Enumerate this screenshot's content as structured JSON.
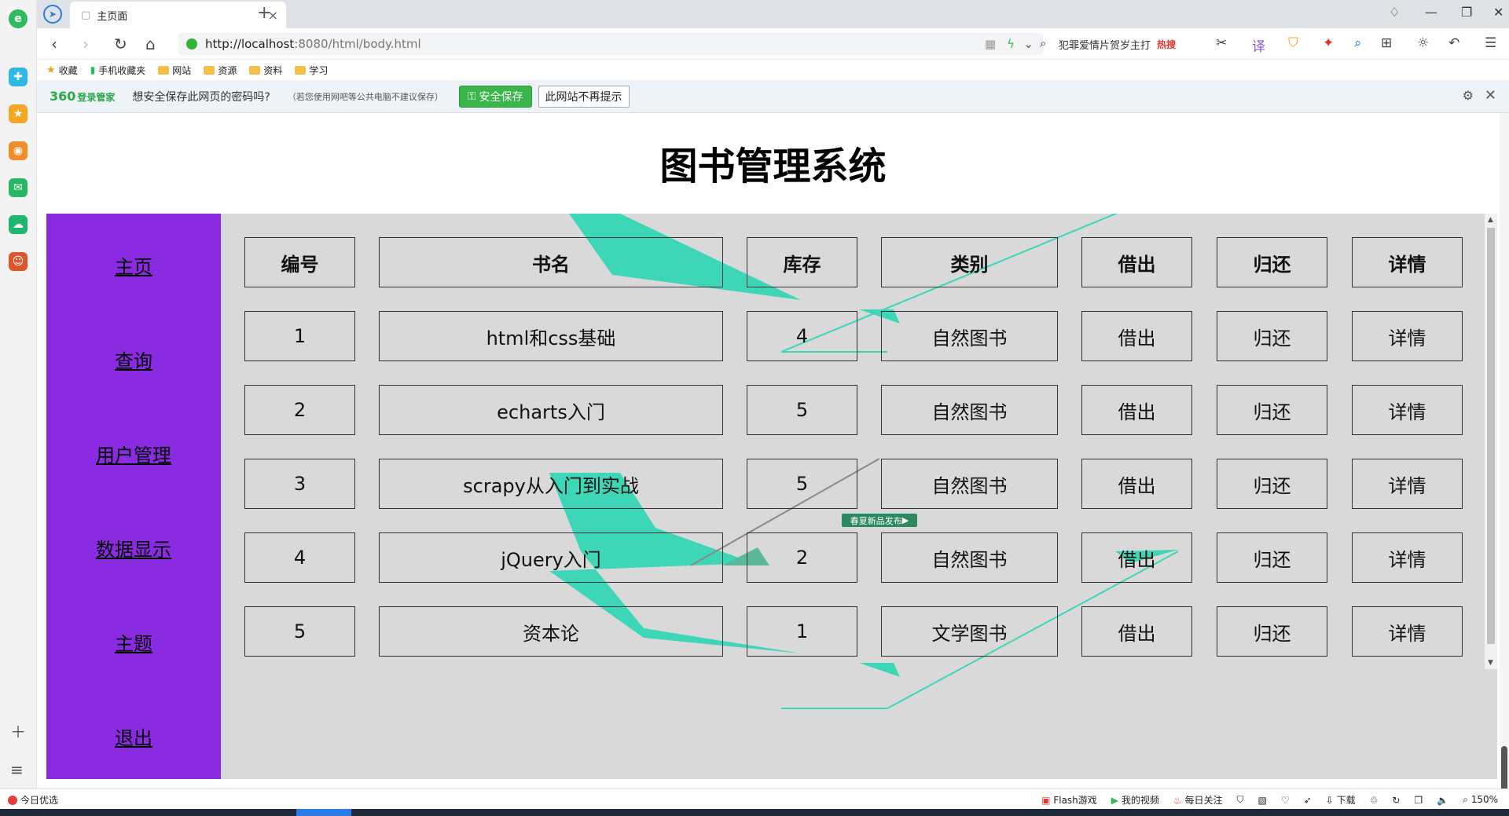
{
  "browser": {
    "tab_title": "主页面",
    "tab_close": "×",
    "new_tab": "+",
    "url_host": "http://localhost",
    "url_rest": ":8080/html/body.html",
    "search_text": "犯罪爱情片贺岁主打",
    "search_hot": "热搜"
  },
  "bookmarks": [
    "收藏",
    "手机收藏夹",
    "网站",
    "资源",
    "资料",
    "学习"
  ],
  "password_bar": {
    "logo": "360",
    "logo_sub": "登录管家",
    "question": "想安全保存此网页的密码吗?",
    "note": "（若您使用网吧等公共电脑不建议保存）",
    "save_label": "安全保存",
    "never_label": "此网站不再提示"
  },
  "page": {
    "title": "图书管理系统",
    "sidebar": [
      "主页",
      "查询",
      "用户管理",
      "数据显示",
      "主题",
      "退出"
    ],
    "table": {
      "headers": [
        "编号",
        "书名",
        "库存",
        "类别",
        "借出",
        "归还",
        "详情"
      ],
      "rows": [
        [
          "1",
          "html和css基础",
          "4",
          "自然图书",
          "借出",
          "归还",
          "详情"
        ],
        [
          "2",
          "echarts入门",
          "5",
          "自然图书",
          "借出",
          "归还",
          "详情"
        ],
        [
          "3",
          "scrapy从入门到实战",
          "5",
          "自然图书",
          "借出",
          "归还",
          "详情"
        ],
        [
          "4",
          "jQuery入门",
          "2",
          "自然图书",
          "借出",
          "归还",
          "详情"
        ],
        [
          "5",
          "资本论",
          "1",
          "文学图书",
          "借出",
          "归还",
          "详情"
        ]
      ]
    },
    "ad_badge": "春夏新品发布"
  },
  "statusbar": {
    "left": "今日优选",
    "items": [
      "Flash游戏",
      "我的视频",
      "每日关注",
      "下载",
      "150%"
    ]
  },
  "colors": {
    "sidebar_purple": "#8a2be2",
    "content_bg": "#d9d9d9",
    "decor_teal": "#3dd6b7",
    "save_green": "#39b54a"
  }
}
